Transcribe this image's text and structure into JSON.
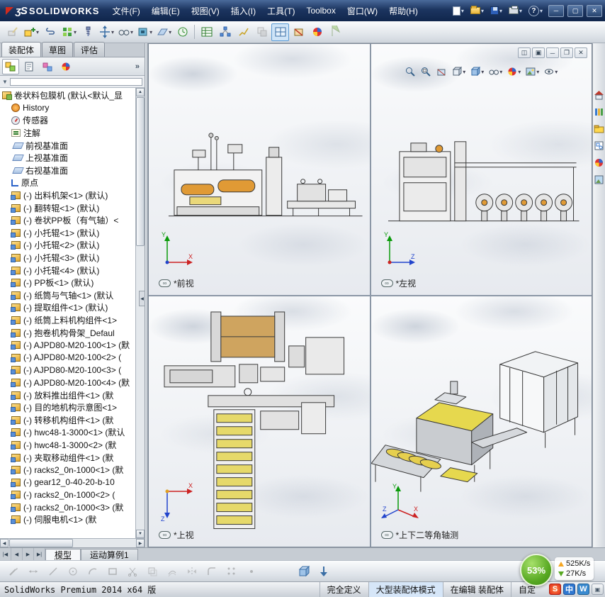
{
  "titlebar": {
    "logo": "SOLIDWORKS",
    "logo_mark": "ʒS",
    "menus": [
      "文件(F)",
      "编辑(E)",
      "视图(V)",
      "插入(I)",
      "工具(T)",
      "Toolbox",
      "窗口(W)",
      "帮助(H)"
    ]
  },
  "glyphs": {
    "dropdown": "▾",
    "minimize": "─",
    "maximize": "▢",
    "restore": "❐",
    "close": "✕",
    "help": "?",
    "chevrons": "»",
    "link": "∞",
    "up": "▲",
    "down": "▼",
    "left": "◀",
    "right": "▶",
    "first": "|◀",
    "last": "▶|",
    "filter": "▼",
    "tile": "◫",
    "box": "▣"
  },
  "command_tabs": [
    {
      "label": "装配体"
    },
    {
      "label": "草图"
    },
    {
      "label": "评估"
    }
  ],
  "tree": {
    "root_label": "卷状料包膜机 (默认<默认_显",
    "items": [
      {
        "label": "History",
        "type": "history"
      },
      {
        "label": "传感器",
        "type": "sensor"
      },
      {
        "label": "注解",
        "type": "annotation"
      },
      {
        "label": "前视基准面",
        "type": "plane"
      },
      {
        "label": "上视基准面",
        "type": "plane"
      },
      {
        "label": "右视基准面",
        "type": "plane"
      },
      {
        "label": "原点",
        "type": "origin"
      },
      {
        "label": "(-) 出料机架<1> (默认)",
        "type": "component"
      },
      {
        "label": "(-) 翻转辊<1> (默认)",
        "type": "component"
      },
      {
        "label": "(-) 卷状PP板（有气轴）<",
        "type": "component"
      },
      {
        "label": "(-) 小托辊<1> (默认)",
        "type": "component"
      },
      {
        "label": "(-) 小托辊<2> (默认)",
        "type": "component"
      },
      {
        "label": "(-) 小托辊<3> (默认)",
        "type": "component"
      },
      {
        "label": "(-) 小托辊<4> (默认)",
        "type": "component"
      },
      {
        "label": "(-) PP板<1> (默认)",
        "type": "component"
      },
      {
        "label": "(-) 纸筒与气轴<1> (默认",
        "type": "component"
      },
      {
        "label": "(-) 提取组件<1> (默认)",
        "type": "component"
      },
      {
        "label": "(-) 纸筒上料机构组件<1>",
        "type": "component"
      },
      {
        "label": "(-) 抱卷机构骨架_Defaul",
        "type": "component"
      },
      {
        "label": "(-) AJPD80-M20-100<1> (默",
        "type": "component"
      },
      {
        "label": "(-) AJPD80-M20-100<2> (",
        "type": "component"
      },
      {
        "label": "(-) AJPD80-M20-100<3> (",
        "type": "component"
      },
      {
        "label": "(-) AJPD80-M20-100<4> (默",
        "type": "component"
      },
      {
        "label": "(-) 放料推出组件<1> (默",
        "type": "component"
      },
      {
        "label": "(-) 目的地机构示意图<1>",
        "type": "component"
      },
      {
        "label": "(-) 转移机构组件<1> (默",
        "type": "component"
      },
      {
        "label": "(-) hwc48-1-3000<1> (默认",
        "type": "component"
      },
      {
        "label": "(-) hwc48-1-3000<2> (默",
        "type": "component"
      },
      {
        "label": "(-) 夹取移动组件<1> (默",
        "type": "component"
      },
      {
        "label": "(-) racks2_0n-1000<1> (默",
        "type": "component"
      },
      {
        "label": "(-) gear12_0-40-20-b-10",
        "type": "component"
      },
      {
        "label": "(-) racks2_0n-1000<2> (",
        "type": "component"
      },
      {
        "label": "(-) racks2_0n-1000<3> (默",
        "type": "component"
      },
      {
        "label": "(-) 伺服电机<1> (默",
        "type": "component"
      }
    ]
  },
  "viewports": {
    "front": {
      "label": "*前视"
    },
    "left": {
      "label": "*左视"
    },
    "top": {
      "label": "*上视"
    },
    "iso": {
      "label": "*上下二等角轴测"
    }
  },
  "axes": {
    "x": "X",
    "y": "Y",
    "z": "Z"
  },
  "doc_tabs": [
    {
      "label": "模型"
    },
    {
      "label": "运动算例1"
    }
  ],
  "statusbar": {
    "app_version": "SolidWorks Premium 2014 x64 版",
    "define_state": "完全定义",
    "assembly_mode": "大型装配体模式",
    "edit_state": "在编辑 装配体",
    "custom": "自定"
  },
  "overlay": {
    "cpu_gauge": "53%",
    "upload": "525K/s",
    "download": "27K/s"
  },
  "tray": {
    "sogou": "S",
    "cn": "中",
    "w": "W"
  }
}
